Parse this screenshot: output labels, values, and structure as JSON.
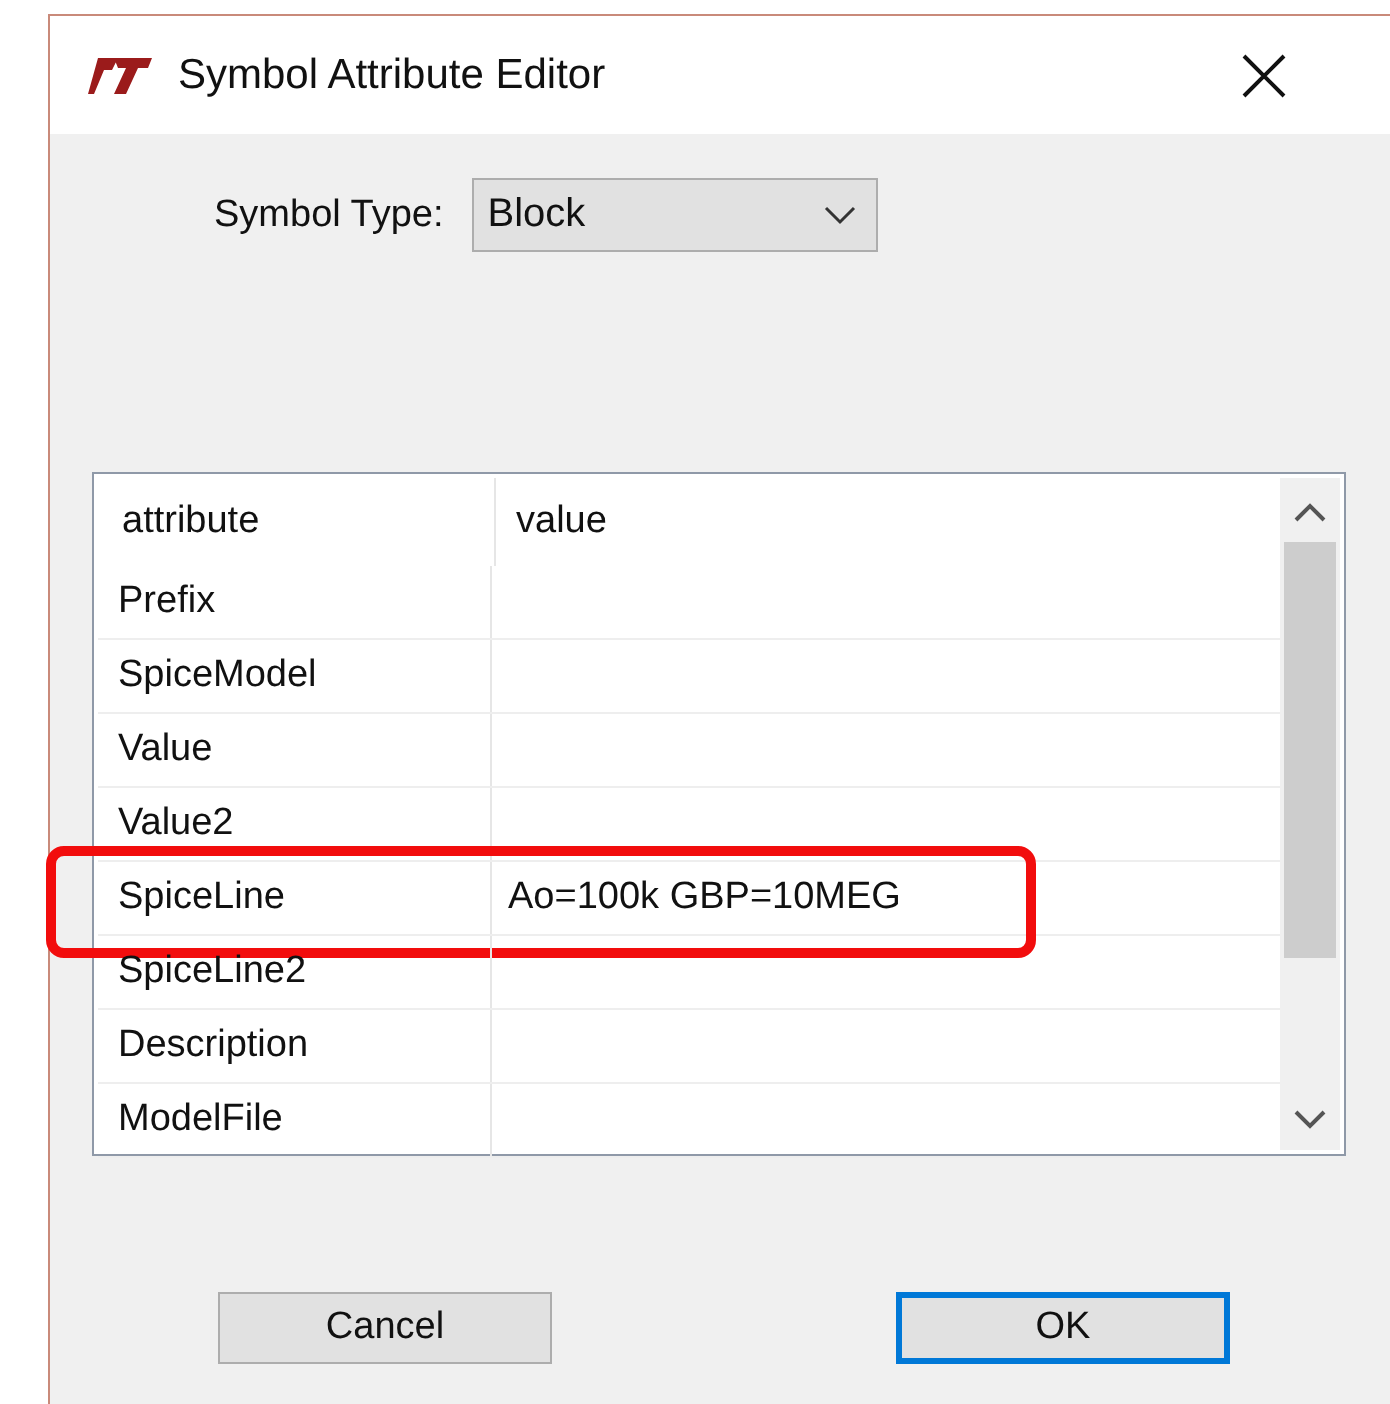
{
  "window": {
    "title": "Symbol Attribute Editor"
  },
  "symbol_type": {
    "label": "Symbol Type:",
    "value": "Block"
  },
  "table": {
    "columns": [
      "attribute",
      "value"
    ],
    "rows": [
      {
        "attribute": "Prefix",
        "value": "",
        "highlighted": false
      },
      {
        "attribute": "SpiceModel",
        "value": "",
        "highlighted": false
      },
      {
        "attribute": "Value",
        "value": "",
        "highlighted": false
      },
      {
        "attribute": "Value2",
        "value": "",
        "highlighted": false
      },
      {
        "attribute": "SpiceLine",
        "value": "Ao=100k GBP=10MEG",
        "highlighted": true
      },
      {
        "attribute": "SpiceLine2",
        "value": "",
        "highlighted": false
      },
      {
        "attribute": "Description",
        "value": "",
        "highlighted": false
      },
      {
        "attribute": "ModelFile",
        "value": "",
        "highlighted": false
      }
    ]
  },
  "buttons": [
    {
      "label": "Cancel",
      "default": false
    },
    {
      "label": "OK",
      "default": true
    }
  ]
}
